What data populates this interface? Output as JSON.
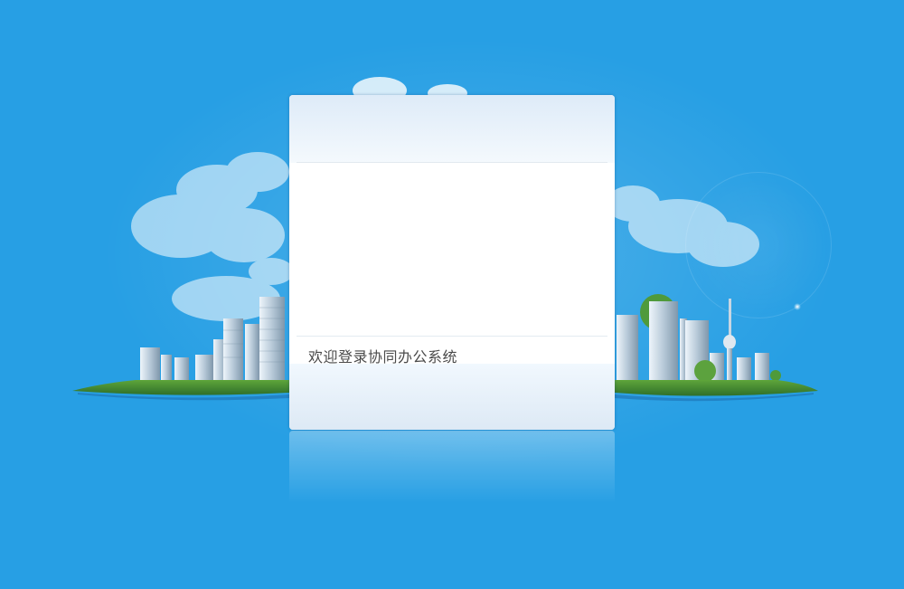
{
  "login": {
    "welcome_text": "欢迎登录协同办公系统"
  },
  "colors": {
    "background": "#279fe4",
    "panel_top": "#deebf8",
    "panel_bottom": "#dde9f5",
    "text": "#4a4a4a"
  }
}
